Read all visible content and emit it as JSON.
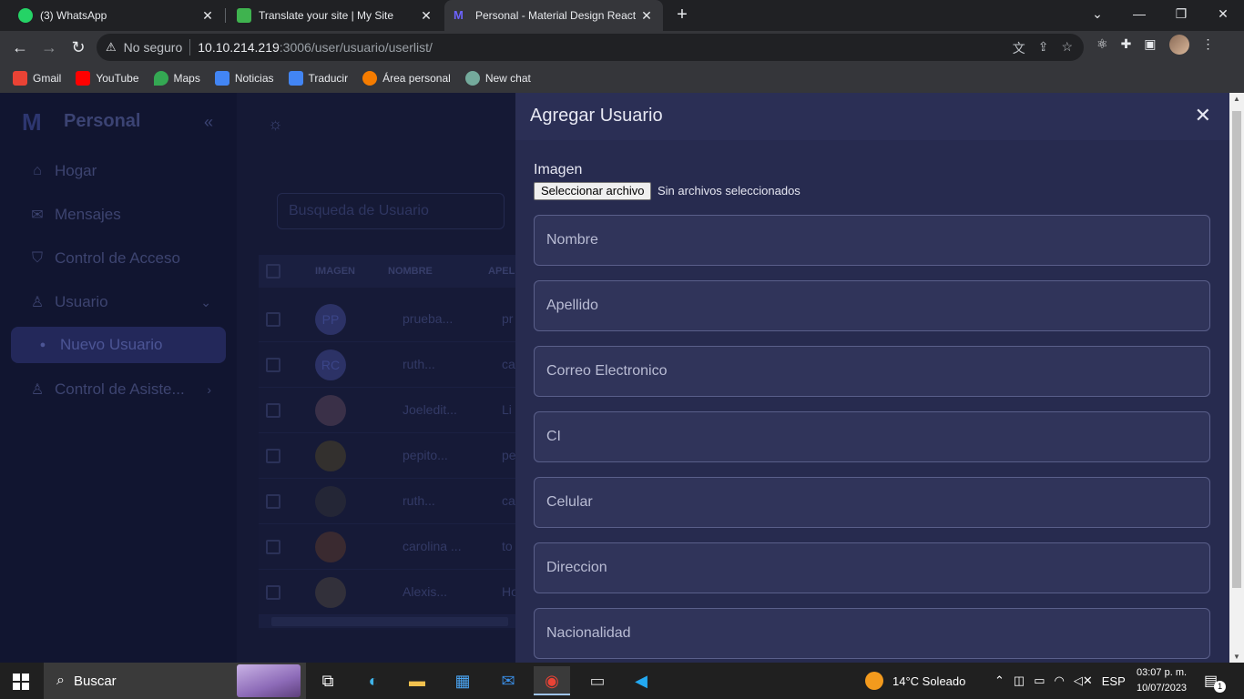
{
  "browser": {
    "tabs": [
      {
        "title": "(3) WhatsApp",
        "color": "#25d366"
      },
      {
        "title": "Translate your site | My Site",
        "color": "#3fb34f"
      },
      {
        "title": "Personal - Material Design React",
        "color": "#6c63ff"
      }
    ],
    "address": {
      "security": "No seguro",
      "host": "10.10.214.219",
      "path": ":3006/user/usuario/userlist/"
    },
    "bookmarks": [
      {
        "label": "Gmail",
        "color": "#ea4335"
      },
      {
        "label": "YouTube",
        "color": "#ff0000"
      },
      {
        "label": "Maps",
        "color": "#34a853"
      },
      {
        "label": "Noticias",
        "color": "#4285f4"
      },
      {
        "label": "Traducir",
        "color": "#4285f4"
      },
      {
        "label": "Área personal",
        "color": "#f57c00"
      },
      {
        "label": "New chat",
        "color": "#74aa9c"
      }
    ]
  },
  "app": {
    "logo": "Personal",
    "sidebar": {
      "items": [
        {
          "label": "Hogar",
          "icon": "home-icon"
        },
        {
          "label": "Mensajes",
          "icon": "mail-icon"
        },
        {
          "label": "Control de Acceso",
          "icon": "shield-icon"
        },
        {
          "label": "Usuario",
          "icon": "user-icon"
        },
        {
          "label": "Nuevo Usuario",
          "icon": "user-small-icon"
        },
        {
          "label": "Control de Asiste...",
          "icon": "user-icon"
        }
      ]
    },
    "search_placeholder": "Busqueda de Usuario",
    "table": {
      "headers": [
        "IMAGEN",
        "NOMBRE",
        "APELL"
      ],
      "rows": [
        {
          "initials": "PP",
          "name": "prueba...",
          "last": "pr"
        },
        {
          "initials": "RC",
          "name": "ruth...",
          "last": "ca"
        },
        {
          "initials": "",
          "name": "Joeledit...",
          "last": "Li"
        },
        {
          "initials": "",
          "name": "pepito...",
          "last": "pe"
        },
        {
          "initials": "",
          "name": "ruth...",
          "last": "ca"
        },
        {
          "initials": "",
          "name": "carolina ...",
          "last": "to"
        },
        {
          "initials": "",
          "name": "Alexis...",
          "last": "Ho"
        }
      ]
    }
  },
  "drawer": {
    "title": "Agregar Usuario",
    "image_label": "Imagen",
    "file_button": "Seleccionar archivo",
    "file_status": "Sin archivos seleccionados",
    "fields": [
      "Nombre",
      "Apellido",
      "Correo Electronico",
      "CI",
      "Celular",
      "Direccion",
      "Nacionalidad"
    ]
  },
  "taskbar": {
    "search": "Buscar",
    "weather": "14°C  Soleado",
    "lang": "ESP",
    "time": "03:07 p. m.",
    "date": "10/07/2023",
    "badge": "1"
  }
}
